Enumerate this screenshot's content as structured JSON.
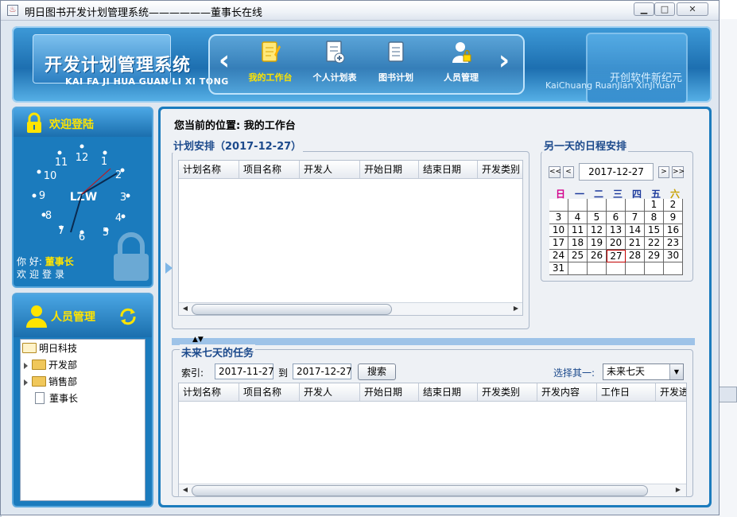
{
  "window": {
    "title": "明日图书开发计划管理系统——————董事长在线",
    "min_glyph": "▁",
    "max_glyph": "□",
    "close_glyph": "✕"
  },
  "header": {
    "logo_title": "开发计划管理系统",
    "logo_subtitle": "KAI FA JI HUA  GUAN LI XI TONG",
    "nav": [
      {
        "label": "我的工作台",
        "icon": "edit-notepad-icon",
        "active": true
      },
      {
        "label": "个人计划表",
        "icon": "document-add-icon",
        "active": false
      },
      {
        "label": "图书计划",
        "icon": "book-icon",
        "active": false
      },
      {
        "label": "人员管理",
        "icon": "user-lock-icon",
        "active": false
      }
    ],
    "slogan_cn": "开创软件新纪元",
    "slogan_en": "KaiChuang RuanJian XinJiYuan"
  },
  "login_panel": {
    "title": "欢迎登陆",
    "clock_brand": "LZW",
    "hello_prefix": "你 好:",
    "user_name": "董事长",
    "welcome_text": "欢迎登录"
  },
  "staff_panel": {
    "title": "人员管理",
    "tree": [
      {
        "label": "明日科技",
        "type": "folder-open",
        "level": 0
      },
      {
        "label": "开发部",
        "type": "folder",
        "level": 1
      },
      {
        "label": "销售部",
        "type": "folder",
        "level": 1
      },
      {
        "label": "董事长",
        "type": "leaf",
        "level": 1
      }
    ]
  },
  "main": {
    "location_label": "您当前的位置:",
    "location_value": "我的工作台",
    "plan_section": {
      "title": "计划安排（2017-12-27）",
      "columns": [
        "计划名称",
        "项目名称",
        "开发人",
        "开始日期",
        "结束日期",
        "开发类别"
      ]
    },
    "calendar_section": {
      "title": "另一天的日程安排",
      "nav_first": "<<",
      "nav_prev": "<",
      "nav_next": ">",
      "nav_last": ">>",
      "date": "2017-12-27",
      "weekdays": [
        "日",
        "一",
        "二",
        "三",
        "四",
        "五",
        "六"
      ],
      "weekday_colors": [
        "#d4008c",
        "#1c3a9c",
        "#1c3a9c",
        "#1c3a9c",
        "#1c3a9c",
        "#1c3a9c",
        "#c8a000"
      ],
      "days": [
        "",
        "",
        "",
        "",
        "",
        "1",
        "2",
        "3",
        "4",
        "5",
        "6",
        "7",
        "8",
        "9",
        "10",
        "11",
        "12",
        "13",
        "14",
        "15",
        "16",
        "17",
        "18",
        "19",
        "20",
        "21",
        "22",
        "23",
        "24",
        "25",
        "26",
        "27",
        "28",
        "29",
        "30",
        "31",
        "",
        "",
        "",
        "",
        "",
        ""
      ],
      "today": "27"
    },
    "task_section": {
      "title": "未来七天的任务",
      "index_label": "索引:",
      "start_date": "2017-11-27",
      "to_label": "到",
      "end_date": "2017-12-27",
      "search_button": "搜索",
      "choose_label": "选择其一:",
      "range_value": "未来七天",
      "columns": [
        "计划名称",
        "项目名称",
        "开发人",
        "开始日期",
        "结束日期",
        "开发类别",
        "开发内容",
        "工作日",
        "开发进"
      ]
    }
  }
}
